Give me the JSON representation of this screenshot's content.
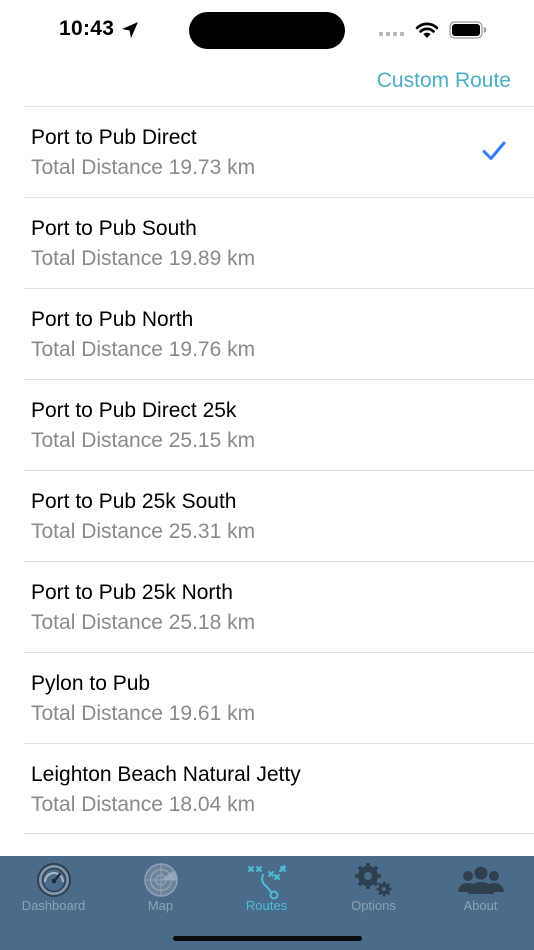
{
  "status_bar": {
    "time": "10:43"
  },
  "nav": {
    "custom_route_label": "Custom Route"
  },
  "routes": [
    {
      "name": "Port to Pub Direct",
      "distance": "Total Distance 19.73 km",
      "selected": true
    },
    {
      "name": "Port to Pub South",
      "distance": "Total Distance 19.89 km",
      "selected": false
    },
    {
      "name": "Port to Pub North",
      "distance": "Total Distance 19.76 km",
      "selected": false
    },
    {
      "name": "Port to Pub Direct 25k",
      "distance": "Total Distance 25.15 km",
      "selected": false
    },
    {
      "name": "Port to Pub 25k South",
      "distance": "Total Distance 25.31 km",
      "selected": false
    },
    {
      "name": "Port to Pub 25k North",
      "distance": "Total Distance 25.18 km",
      "selected": false
    },
    {
      "name": "Pylon to Pub",
      "distance": "Total Distance 19.61 km",
      "selected": false
    },
    {
      "name": "Leighton Beach Natural Jetty",
      "distance": "Total Distance 18.04 km",
      "selected": false
    }
  ],
  "tabs": [
    {
      "label": "Dashboard",
      "icon": "dashboard-gauge-icon",
      "active": false
    },
    {
      "label": "Map",
      "icon": "radar-map-icon",
      "active": false
    },
    {
      "label": "Routes",
      "icon": "route-plan-icon",
      "active": true
    },
    {
      "label": "Options",
      "icon": "gears-icon",
      "active": false
    },
    {
      "label": "About",
      "icon": "people-icon",
      "active": false
    }
  ],
  "colors": {
    "accent": "#4aaec4",
    "checkmark": "#2f7cf6",
    "tab_bar": "#4a6b89",
    "tab_inactive": "#8da2b6",
    "tab_active": "#4fbcd6",
    "secondary_text": "#8a8a8e"
  }
}
